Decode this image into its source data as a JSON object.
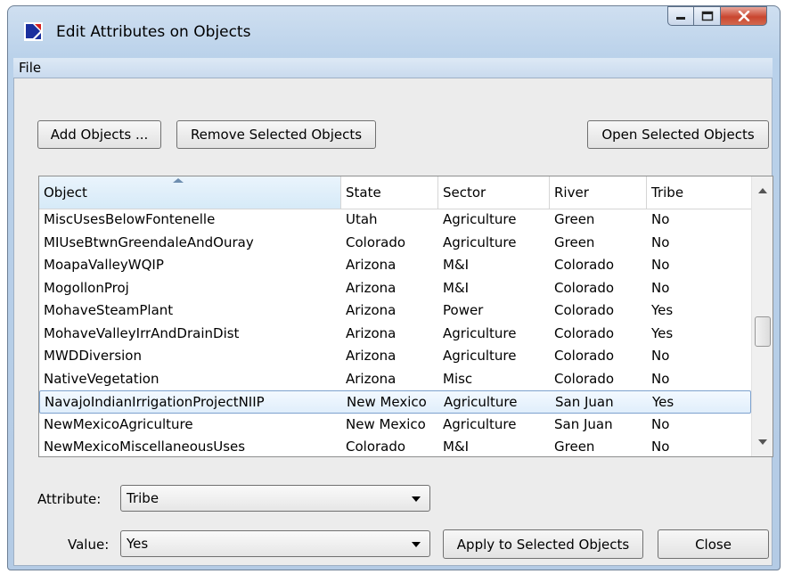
{
  "window": {
    "title": "Edit Attributes on Objects"
  },
  "menu": {
    "file": "File"
  },
  "toolbar": {
    "add_objects": "Add Objects ...",
    "remove_selected": "Remove Selected Objects",
    "open_selected": "Open Selected Objects"
  },
  "table": {
    "columns": [
      "Object",
      "State",
      "Sector",
      "River",
      "Tribe"
    ],
    "sorted_column": "Object",
    "rows": [
      [
        "MiscUsesBelowFontenelle",
        "Utah",
        "Agriculture",
        "Green",
        "No"
      ],
      [
        "MIUseBtwnGreendaleAndOuray",
        "Colorado",
        "Agriculture",
        "Green",
        "No"
      ],
      [
        "MoapaValleyWQIP",
        "Arizona",
        "M&I",
        "Colorado",
        "No"
      ],
      [
        "MogollonProj",
        "Arizona",
        "M&I",
        "Colorado",
        "No"
      ],
      [
        "MohaveSteamPlant",
        "Arizona",
        "Power",
        "Colorado",
        "Yes"
      ],
      [
        "MohaveValleyIrrAndDrainDist",
        "Arizona",
        "Agriculture",
        "Colorado",
        "Yes"
      ],
      [
        "MWDDiversion",
        "Arizona",
        "Agriculture",
        "Colorado",
        "No"
      ],
      [
        "NativeVegetation",
        "Arizona",
        "Misc",
        "Colorado",
        "No"
      ],
      [
        "NavajoIndianIrrigationProjectNIIP",
        "New Mexico",
        "Agriculture",
        "San Juan",
        "Yes"
      ],
      [
        "NewMexicoAgriculture",
        "New Mexico",
        "Agriculture",
        "San Juan",
        "No"
      ],
      [
        "NewMexicoMiscellaneousUses",
        "Colorado",
        "M&I",
        "Green",
        "No"
      ]
    ],
    "selected_row": "NavajoIndianIrrigationProjectNIIP"
  },
  "form": {
    "attribute_label": "Attribute:",
    "attribute_value": "Tribe",
    "value_label": "Value:",
    "value_value": "Yes"
  },
  "actions": {
    "apply": "Apply to Selected Objects",
    "close": "Close"
  },
  "colors": {
    "title_gradient": "#b9d1ea",
    "selection_border": "#7da2ce",
    "close_button": "#c9462f"
  }
}
